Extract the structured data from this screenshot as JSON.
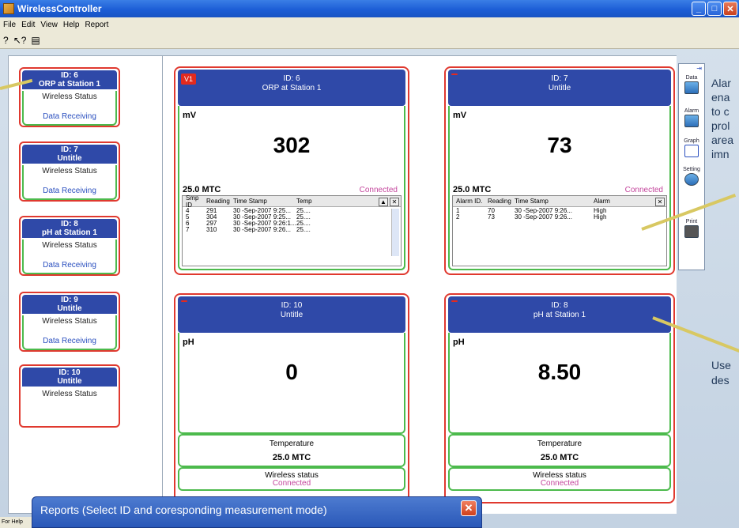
{
  "window": {
    "title": "WirelessController"
  },
  "menu": [
    "File",
    "Edit",
    "View",
    "Help",
    "Report"
  ],
  "toolbar_icons": [
    "about-icon",
    "context-help-icon",
    "report-icon"
  ],
  "left_cards": [
    {
      "id": "ID: 6",
      "name": "ORP at Station 1",
      "status": "Wireless Status",
      "data": "Data Receiving"
    },
    {
      "id": "ID: 7",
      "name": "Untitle",
      "status": "Wireless Status",
      "data": "Data Receiving"
    },
    {
      "id": "ID: 8",
      "name": "pH at Station 1",
      "status": "Wireless Status",
      "data": "Data Receiving"
    },
    {
      "id": "ID: 9",
      "name": "Untitle",
      "status": "Wireless Status",
      "data": "Data Receiving"
    },
    {
      "id": "ID: 10",
      "name": "Untitle",
      "status": "Wireless Status",
      "data": ""
    }
  ],
  "cards": {
    "c1": {
      "tag": "V1",
      "id": "ID: 6",
      "name": "ORP at Station 1",
      "unit": "mV",
      "value": "302",
      "temp": "25.0 MTC",
      "status": "Connected",
      "table": {
        "headers": [
          "Smp ID",
          "Reading",
          "Time Stamp",
          "Temp"
        ],
        "rows": [
          [
            "4",
            "291",
            "30 -Sep-2007 9:25...",
            "25...."
          ],
          [
            "5",
            "304",
            "30 -Sep-2007 9:25...",
            "25...."
          ],
          [
            "6",
            "297",
            "30 -Sep-2007 9:26:1...",
            "25...."
          ],
          [
            "7",
            "310",
            "30 -Sep-2007 9:26...",
            "25...."
          ]
        ]
      }
    },
    "c2": {
      "tag": "",
      "id": "ID: 7",
      "name": "Untitle",
      "unit": "mV",
      "value": "73",
      "temp": "25.0 MTC",
      "status": "Connected",
      "table": {
        "headers": [
          "Alarm ID.",
          "Reading",
          "Time Stamp",
          "Alarm"
        ],
        "rows": [
          [
            "1",
            "70",
            "30 -Sep-2007 9:26...",
            "High"
          ],
          [
            "2",
            "73",
            "30 -Sep-2007 9:26...",
            "High"
          ]
        ]
      }
    },
    "c3": {
      "tag": "",
      "id": "ID: 10",
      "name": "Untitle",
      "unit": "pH",
      "value": "0",
      "temp_label": "Temperature",
      "temp": "25.0 MTC",
      "ws_label": "Wireless status",
      "ws": "Connected"
    },
    "c4": {
      "tag": "",
      "id": "ID: 8",
      "name": "pH at Station 1",
      "unit": "pH",
      "value": "8.50",
      "temp_label": "Temperature",
      "temp": "25.0 MTC",
      "ws_label": "Wireless status",
      "ws": "Connected"
    }
  },
  "right_panel": {
    "pin": "⇥",
    "buttons": [
      "Data",
      "Alarm",
      "Graph",
      "Setting",
      "Print"
    ]
  },
  "side_text": {
    "alarm": [
      "Alar",
      "ena",
      "to c",
      "prol",
      "area",
      "imn"
    ],
    "use": [
      "Use",
      "des"
    ]
  },
  "dialog": {
    "title": "Reports (Select ID and coresponding measurement mode)"
  },
  "status_bar": "For Help"
}
